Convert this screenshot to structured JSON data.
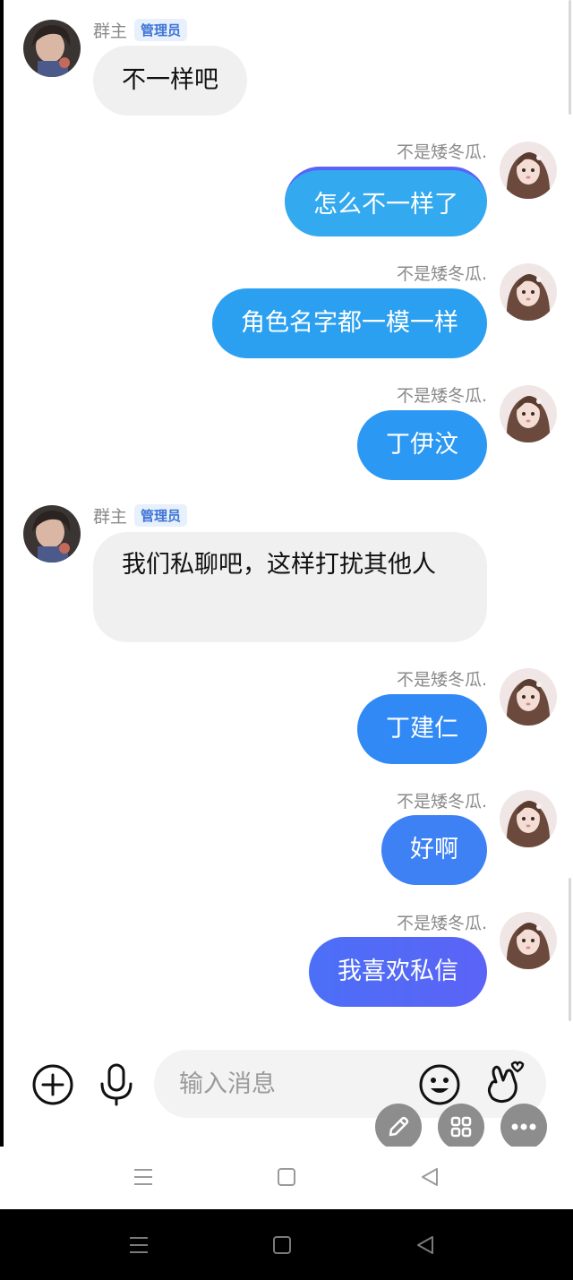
{
  "owner": {
    "label": "群主",
    "badge": "管理员"
  },
  "self_nick": "不是矮冬瓜.",
  "messages": [
    {
      "from": "owner",
      "text": "不一样吧"
    },
    {
      "from": "self",
      "text": "怎么不一样了"
    },
    {
      "from": "self",
      "text": "角色名字都一模一样"
    },
    {
      "from": "self",
      "text": "丁伊汶"
    },
    {
      "from": "owner",
      "text": "我们私聊吧，这样打扰其他人"
    },
    {
      "from": "self",
      "text": "丁建仁"
    },
    {
      "from": "self",
      "text": "好啊"
    },
    {
      "from": "self",
      "text": "我喜欢私信"
    }
  ],
  "input": {
    "placeholder": "输入消息"
  },
  "icons": {
    "add": "plus-circle-icon",
    "voice": "microphone-icon",
    "emoji": "smiley-icon",
    "gesture": "finger-heart-icon",
    "edit": "pencil-icon",
    "apps": "grid-icon",
    "more": "more-dots-icon",
    "nav_menu": "menu-icon",
    "nav_home": "home-square-icon",
    "nav_back": "back-triangle-icon"
  },
  "colors": {
    "bubble_out_1": "#33a9ef",
    "bubble_out_2": "#2ca0f0",
    "bubble_out_3": "#2b98f3",
    "bubble_out_4": "#3089f4",
    "bubble_out_5": "#3d81f5",
    "bubble_out_6": "#4c6ff7",
    "bubble_out_7": "#5b63f6",
    "bubble_in": "#f0f0f0",
    "badge_bg": "#e8f0fc",
    "badge_text": "#3d74d6"
  }
}
